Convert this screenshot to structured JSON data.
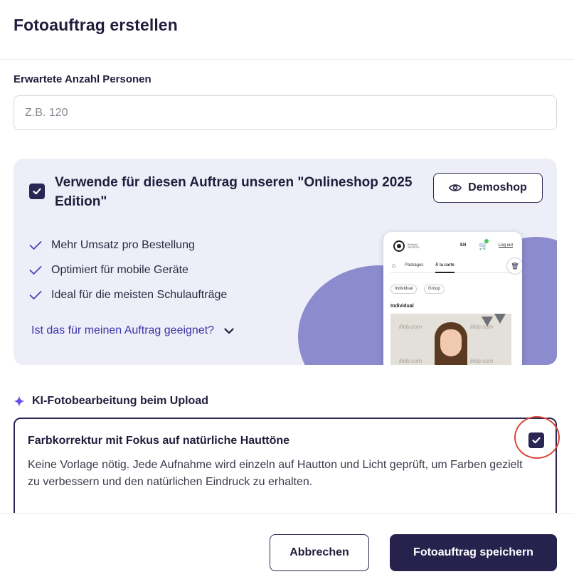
{
  "dialog": {
    "title": "Fotoauftrag erstellen"
  },
  "persons": {
    "label": "Erwartete Anzahl Personen",
    "placeholder": "Z.B. 120",
    "value": ""
  },
  "onlineshop": {
    "checked": true,
    "title": "Verwende für diesen Auftrag unseren \"Onlineshop 2025 Edition\"",
    "demo_button": "Demoshop",
    "demo_icon": "eye-icon",
    "benefits": [
      "Mehr Umsatz pro Bestellung",
      "Optimiert für mobile Geräte",
      "Ideal für die meisten Schulaufträge"
    ],
    "suitable_link": "Ist das für meinen Auftrag geeignet?",
    "preview": {
      "brand_line1": "Beispiel",
      "brand_line2": "SPORTS",
      "language": "EN",
      "logout": "Log out",
      "nav_packages": "Packages",
      "nav_alacarte": "À la carte",
      "chip_individual": "Individual",
      "chip_group": "Group",
      "section": "Individual",
      "watermark": "lilely.com"
    }
  },
  "ki": {
    "icon": "sparkle-icon",
    "heading": "KI-Fotobearbeitung beim Upload",
    "option_title": "Farbkorrektur mit Fokus auf natürliche Hauttöne",
    "option_desc": "Keine Vorlage nötig. Jede Aufnahme wird einzeln auf Hautton und Licht geprüft, um Farben gezielt zu verbessern und den natürlichen Eindruck zu erhalten.",
    "checked": true
  },
  "footer": {
    "cancel": "Abbrechen",
    "save": "Fotoauftrag speichern"
  },
  "colors": {
    "primary": "#26224d",
    "accent_link": "#3a35a8",
    "promo_bg": "#eeeef9",
    "blob": "#8c8bcd",
    "annotation": "#d9483b"
  }
}
